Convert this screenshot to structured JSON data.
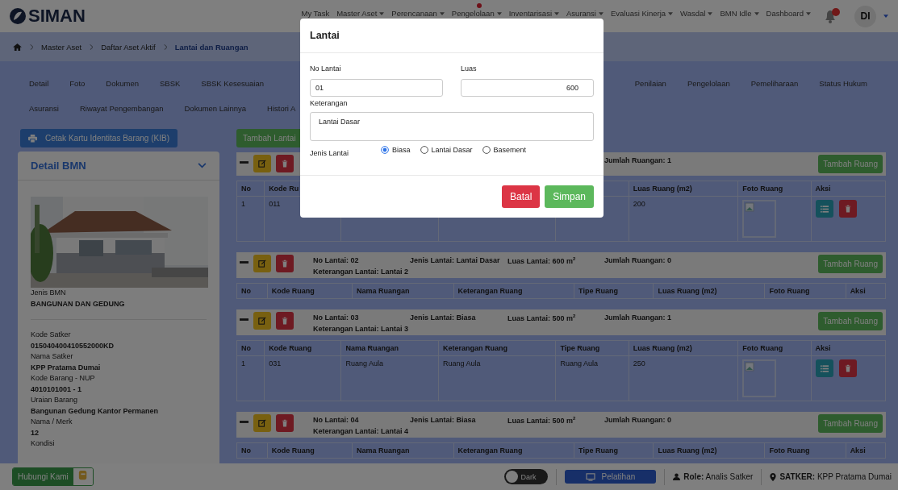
{
  "header": {
    "logo": "SIMAN",
    "nav": [
      {
        "label": "My Task",
        "dropdown": false,
        "dot": false
      },
      {
        "label": "Master Aset",
        "dropdown": true,
        "dot": false
      },
      {
        "label": "Perencanaan",
        "dropdown": true,
        "dot": false
      },
      {
        "label": "Pengelolaan",
        "dropdown": true,
        "dot": true
      },
      {
        "label": "Inventarisasi",
        "dropdown": true,
        "dot": false
      },
      {
        "label": "Asuransi",
        "dropdown": true,
        "dot": false
      },
      {
        "label": "Evaluasi Kinerja",
        "dropdown": true,
        "dot": false
      },
      {
        "label": "Wasdal",
        "dropdown": true,
        "dot": false
      },
      {
        "label": "BMN Idle",
        "dropdown": true,
        "dot": false
      },
      {
        "label": "Dashboard",
        "dropdown": true,
        "dot": false
      }
    ],
    "avatar": "DI"
  },
  "breadcrumb": [
    "Master Aset",
    "Daftar Aset Aktif",
    "Lantai dan Ruangan"
  ],
  "tabs": [
    [
      "Detail",
      "Foto",
      "Dokumen",
      "SBSK",
      "SBSK Kesesuaian",
      "Penilaian",
      "Pengelolaan",
      "Pemeliharaan",
      "Status Hukum"
    ],
    [
      "Asuransi",
      "Riwayat Pengembangan",
      "Dokumen Lainnya",
      "Histori A"
    ]
  ],
  "print_button": "Cetak Kartu Identitas Barang (KIB)",
  "detail_card": {
    "title": "Detail BMN",
    "picture": {
      "kind": "picture"
    },
    "groups": [
      [
        {
          "label": "Jenis BMN",
          "value": "BANGUNAN DAN GEDUNG"
        }
      ],
      [
        {
          "label": "Kode Satker",
          "value": "015040400410552000KD"
        },
        {
          "label": "Nama Satker",
          "value": "KPP Pratama Dumai"
        },
        {
          "label": "Kode Barang - NUP",
          "value": "4010101001 - 1"
        },
        {
          "label": "Uraian Barang",
          "value": "Bangunan Gedung Kantor Permanen"
        },
        {
          "label": "Nama / Merk",
          "value": "12"
        },
        {
          "label": "Kondisi"
        }
      ]
    ]
  },
  "add_floor_button": "Tambah Lantai",
  "floors": [
    {
      "jumlah": "Jumlah Ruangan: 1",
      "add_room": "Tambah Ruang",
      "columns": [
        {
          "label": "No"
        },
        {
          "label": "Kode Ru"
        },
        {},
        {},
        {},
        {
          "label": "Luas Ruang (m2)"
        },
        {
          "label": "Foto Ruang"
        },
        {
          "label": "Aksi"
        }
      ],
      "rows": [
        {
          "cells": [
            "1",
            "011",
            null,
            null,
            null,
            "200"
          ]
        }
      ]
    },
    {
      "no": "No Lantai: 02",
      "jenis": "Jenis Lantai: Lantai Dasar",
      "luas": "Luas Lantai: 600 m$^{2}$",
      "jumlah": "Jumlah Ruangan: 0",
      "keterangan": "Keterangan Lantai: Lantai 2",
      "add_room": "Tambah Ruang",
      "columns": [
        {
          "label": "No"
        },
        {
          "label": "Kode Ruang"
        },
        {
          "label": "Nama Ruangan"
        },
        {
          "label": "Keterangan Ruang"
        },
        {
          "label": "Tipe Ruang"
        },
        {
          "label": "Luas Ruang (m2)"
        },
        {
          "label": "Foto Ruang"
        },
        {
          "label": "Aksi"
        }
      ]
    },
    {
      "no": "No Lantai: 03",
      "jenis": "Jenis Lantai: Biasa",
      "luas": "Luas Lantai: 500 m$^{2}$",
      "jumlah": "Jumlah Ruangan: 1",
      "keterangan": "Keterangan Lantai: Lantai 3",
      "add_room": "Tambah Ruang",
      "columns": [
        {
          "label": "No"
        },
        {
          "label": "Kode Ruang"
        },
        {
          "label": "Nama Ruangan"
        },
        {
          "label": "Keterangan Ruang"
        },
        {
          "label": "Tipe Ruang"
        },
        {
          "label": "Luas Ruang (m2)"
        },
        {
          "label": "Foto Ruang"
        },
        {
          "label": "Aksi"
        }
      ],
      "rows": [
        {
          "cells": [
            "1",
            "031",
            "Ruang Aula",
            "Ruang Aula",
            "Ruang Aula",
            "250"
          ]
        }
      ]
    },
    {
      "no": "No Lantai: 04",
      "jenis": "Jenis Lantai: Biasa",
      "luas": "Luas Lantai: 500 m$^{2}$",
      "jumlah": "Jumlah Ruangan: 0",
      "keterangan": "Keterangan Lantai: Lantai 4",
      "add_room": "Tambah Ruang",
      "columns": [
        {
          "label": "No"
        },
        {
          "label": "Kode Ruang"
        },
        {
          "label": "Nama Ruangan"
        },
        {
          "label": "Keterangan Ruang"
        },
        {
          "label": "Tipe Ruang"
        },
        {
          "label": "Luas Ruang (m2)"
        },
        {
          "label": "Foto Ruang"
        },
        {
          "label": "Aksi"
        }
      ]
    }
  ],
  "footer": {
    "contact": "Hubungi Kami",
    "dark_toggle": {
      "label": "Dark",
      "on": false
    },
    "training": "Pelatihan",
    "role": "**Role:** Analis Satker",
    "satker": "**SATKER:** KPP Pratama Dumai"
  },
  "modal": {
    "title": "Lantai",
    "no_lantai": {
      "label": "No Lantai",
      "value": "01"
    },
    "luas": {
      "label": "Luas",
      "value": "600"
    },
    "keterangan": {
      "label": "Keterangan",
      "value": "Lantai Dasar"
    },
    "jenis": {
      "label": "Jenis Lantai",
      "options": [
        {
          "label": "Biasa",
          "selected": true
        },
        {
          "label": "Lantai Dasar",
          "selected": false
        },
        {
          "label": "Basement",
          "selected": false
        }
      ]
    },
    "cancel": "Batal",
    "save": "Simpan"
  }
}
